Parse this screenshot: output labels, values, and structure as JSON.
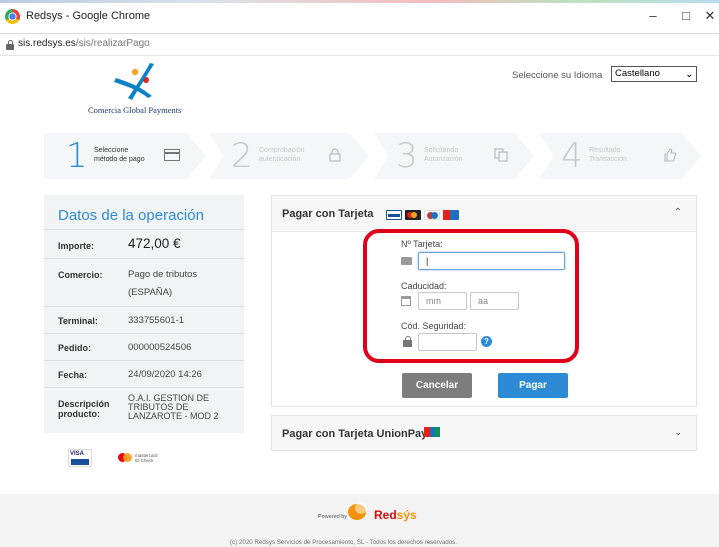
{
  "window": {
    "title": "Redsys - Google Chrome",
    "minimize": "–",
    "maximize": "□",
    "close": "✕"
  },
  "address": {
    "host": "sis.redsys.es",
    "path": "/sis/realizarPago"
  },
  "header": {
    "logo_caption": "Comercia Global Payments",
    "language_label": "Seleccione su Idioma",
    "language_selected": "Castellano"
  },
  "steps": [
    {
      "number": "1",
      "label_line1": "Seleccione",
      "label_line2": "método de pago",
      "icon": "credit-card-icon",
      "active": true
    },
    {
      "number": "2",
      "label_line1": "Comprobación",
      "label_line2": "autenticación",
      "icon": "lock-icon",
      "active": false
    },
    {
      "number": "3",
      "label_line1": "Solicitando",
      "label_line2": "Autorización",
      "icon": "documents-icon",
      "active": false
    },
    {
      "number": "4",
      "label_line1": "Resultado",
      "label_line2": "Transacción",
      "icon": "thumbs-up-icon",
      "active": false
    }
  ],
  "operation": {
    "title": "Datos de la operación",
    "rows": [
      {
        "key": "Importe:",
        "value": "472,00 €"
      },
      {
        "key": "Comercio:",
        "value_line1": "Pago de tributos",
        "value_line2": "(ESPAÑA)"
      },
      {
        "key": "Terminal:",
        "value": "333755601-1"
      },
      {
        "key": "Pedido:",
        "value": "000000524506"
      },
      {
        "key": "Fecha:",
        "value": "24/09/2020 14:26"
      },
      {
        "key_line1": "Descripción",
        "key_line2": "producto:",
        "value_line1": "O.A.I. GESTION DE",
        "value_line2": "TRIBUTOS DE",
        "value_line3": "LANZAROTE - MOD 2"
      }
    ],
    "brand_visa": "VISA",
    "brand_mc_line1": "mastercard",
    "brand_mc_line2": "ID Check"
  },
  "card_form": {
    "title": "Pagar con Tarjeta",
    "card_number_label": "Nº Tarjeta:",
    "card_number_value": "|",
    "expiry_label": "Caducidad:",
    "month_placeholder": "mm",
    "year_placeholder": "aa",
    "cvv_label": "Cód. Seguridad:",
    "help": "?",
    "cancel_label": "Cancelar",
    "pay_label": "Pagar",
    "collapse": "⌃",
    "mini_brand_colors": [
      "#1a4f9a",
      "#e2231a",
      "#c0392b",
      "#1e6fc0"
    ]
  },
  "unionpay": {
    "title": "Pagar con Tarjeta UnionPay",
    "expand": "⌄"
  },
  "footer": {
    "powered_by": "Powered by",
    "brand_red": "Red",
    "brand_sys": "sýs",
    "copyright": "(c) 2020 Redsys Servicios de Procesamiento, SL - Todos los derechos reservados."
  }
}
